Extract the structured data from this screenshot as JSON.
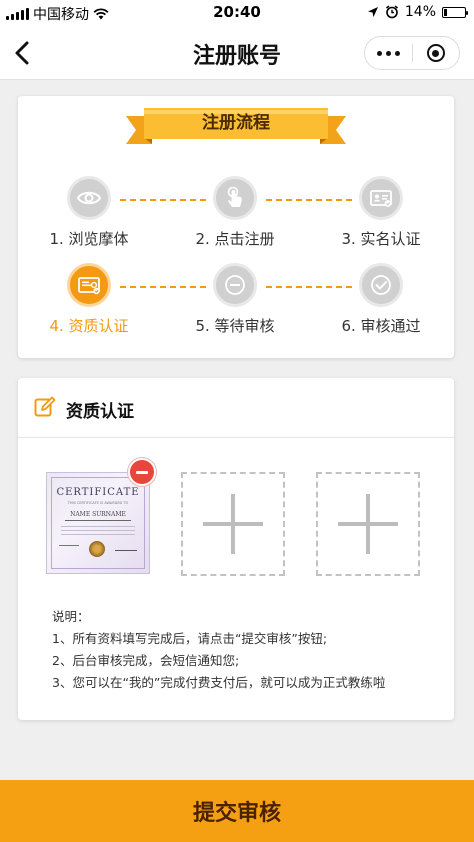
{
  "status_bar": {
    "carrier": "中国移动",
    "time": "20:40",
    "battery": "14%",
    "battery_level": 0.14
  },
  "nav": {
    "title": "注册账号",
    "back_icon": "chevron-left-icon",
    "more_icon": "more-dots-icon",
    "close_icon": "target-close-icon"
  },
  "process": {
    "title": "注册流程",
    "steps": [
      {
        "label": "1. 浏览摩体",
        "icon": "eye-icon",
        "active": false
      },
      {
        "label": "2. 点击注册",
        "icon": "tap-hand-icon",
        "active": false
      },
      {
        "label": "3. 实名认证",
        "icon": "id-card-icon",
        "active": false
      },
      {
        "label": "4. 资质认证",
        "icon": "certificate-icon",
        "active": true
      },
      {
        "label": "5. 等待审核",
        "icon": "minus-circle-icon",
        "active": false
      },
      {
        "label": "6. 审核通过",
        "icon": "check-circle-icon",
        "active": false
      }
    ]
  },
  "qualification": {
    "title": "资质认证",
    "header_icon": "edit-icon",
    "certificate": {
      "title": "CERTIFICATE",
      "subtitle": "THIS CERTIFICATE IS AWARDED TO",
      "name": "NAME SURNAME"
    },
    "notes": [
      "说明：",
      "1、所有资料填写完成后，请点击“提交审核”按钮;",
      "2、后台审核完成，会短信通知您;",
      "3、您可以在“我的”完成付费支付后，就可以成为正式教练啦"
    ]
  },
  "submit": {
    "label": "提交审核"
  },
  "colors": {
    "accent": "#f39a12",
    "submit_bg": "#f5a013",
    "remove": "#e8453c",
    "inactive_step": "#d0d0d0"
  }
}
